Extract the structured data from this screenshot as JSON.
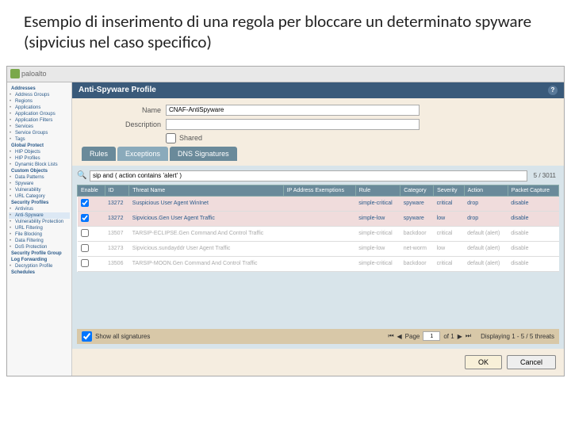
{
  "slide_title": "Esempio di inserimento di una regola per bloccare un determinato spyware (sipvicius nel caso specifico)",
  "logo_text": "paloalto",
  "panel_title": "Anti-Spyware Profile",
  "form": {
    "name_label": "Name",
    "name_value": "CNAF-AntiSpyware",
    "desc_label": "Description",
    "desc_value": "",
    "shared_label": "Shared"
  },
  "tabs": [
    "Rules",
    "Exceptions",
    "DNS Signatures"
  ],
  "search": {
    "value": "sip and ( action contains 'alert' )",
    "count": "5 / 3011"
  },
  "columns": [
    "Enable",
    "ID",
    "Threat Name",
    "IP Address Exemptions",
    "Rule",
    "Category",
    "Severity",
    "Action",
    "Packet Capture"
  ],
  "rows": [
    {
      "enabled": true,
      "id": "13272",
      "name": "Suspicious User Agent WinInet",
      "rule": "simple-critical",
      "category": "spyware",
      "severity": "critical",
      "action": "drop",
      "capture": "disable"
    },
    {
      "enabled": true,
      "id": "13272",
      "name": "Sipvicious.Gen User Agent Traffic",
      "rule": "simple-low",
      "category": "spyware",
      "severity": "low",
      "action": "drop",
      "capture": "disable"
    },
    {
      "enabled": false,
      "id": "13507",
      "name": "TARSIP-ECLIPSE.Gen Command And Control Traffic",
      "rule": "simple-critical",
      "category": "backdoor",
      "severity": "critical",
      "action": "default (alert)",
      "capture": "disable"
    },
    {
      "enabled": false,
      "id": "13273",
      "name": "Sipvicious.sundayddr User Agent Traffic",
      "rule": "simple-low",
      "category": "net-worm",
      "severity": "low",
      "action": "default (alert)",
      "capture": "disable"
    },
    {
      "enabled": false,
      "id": "13506",
      "name": "TARSIP-MOON.Gen Command And Control Traffic",
      "rule": "simple-critical",
      "category": "backdoor",
      "severity": "critical",
      "action": "default (alert)",
      "capture": "disable"
    }
  ],
  "footer": {
    "show_all": "Show all signatures",
    "page_label": "Page",
    "page_value": "1",
    "page_of": "of 1",
    "display": "Displaying 1 - 5 / 5 threats"
  },
  "buttons": {
    "ok": "OK",
    "cancel": "Cancel"
  },
  "sidebar_groups": [
    {
      "label": "Addresses",
      "items": [
        "Address Groups",
        "Regions",
        "Applications",
        "Application Groups",
        "Application Filters",
        "Services",
        "Service Groups",
        "Tags"
      ]
    },
    {
      "label": "Global Protect",
      "items": [
        "HIP Objects",
        "HIP Profiles",
        "Dynamic Block Lists"
      ]
    },
    {
      "label": "Custom Objects",
      "items": [
        "Data Patterns",
        "Spyware",
        "Vulnerability",
        "URL Category"
      ]
    },
    {
      "label": "Security Profiles",
      "items": [
        "Antivirus",
        "Anti-Spyware",
        "Vulnerability Protection",
        "URL Filtering",
        "File Blocking",
        "Data Filtering",
        "DoS Protection"
      ]
    },
    {
      "label": "Security Profile Group",
      "items": []
    },
    {
      "label": "Log Forwarding",
      "items": [
        "Decryption Profile"
      ]
    },
    {
      "label": "Schedules",
      "items": []
    }
  ]
}
